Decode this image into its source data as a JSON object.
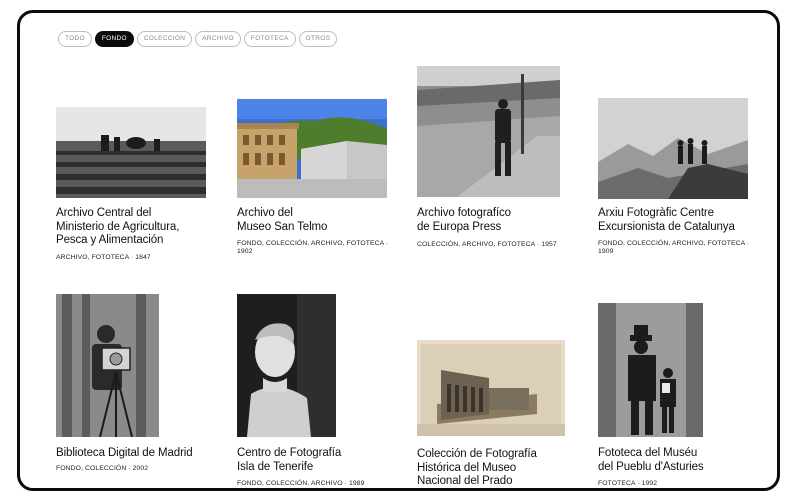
{
  "filters": [
    {
      "label": "TODO",
      "active": false
    },
    {
      "label": "FONDO",
      "active": true
    },
    {
      "label": "COLECCIÓN",
      "active": false
    },
    {
      "label": "ARCHIVO",
      "active": false
    },
    {
      "label": "FOTOTECA",
      "active": false
    },
    {
      "label": "OTROS",
      "active": false
    }
  ],
  "cards": [
    {
      "title": "Archivo Central del\nMinisterio de Agricultura,\nPesca y Alimentación",
      "meta": "ARCHIVO, FOTOTECA · 1847"
    },
    {
      "title": "Archivo del\nMuseo San Telmo",
      "meta": "FONDO, COLECCIÓN, ARCHIVO, FOTOTECA ·\n1902"
    },
    {
      "title": "Archivo fotografíco\nde Europa Press",
      "meta": "COLECCIÓN, ARCHIVO, FOTOTECA · 1957"
    },
    {
      "title": "Arxiu Fotogràfic Centre\nExcursionista de Catalunya",
      "meta": "FONDO, COLECCIÓN, ARCHIVO, FOTOTECA ·\n1909"
    },
    {
      "title": "Biblioteca Digital de Madrid",
      "meta": "FONDO, COLECCIÓN · 2002"
    },
    {
      "title": "Centro de Fotografía\nIsla de Tenerife",
      "meta": "FONDO, COLECCIÓN, ARCHIVO · 1989"
    },
    {
      "title": "Colección de Fotografía\nHistórica del Museo\nNacional del Prado",
      "meta": ""
    },
    {
      "title": "Fototeca del Muséu\ndel Pueblu d'Asturies",
      "meta": "FOTOTECA · 1992"
    }
  ]
}
